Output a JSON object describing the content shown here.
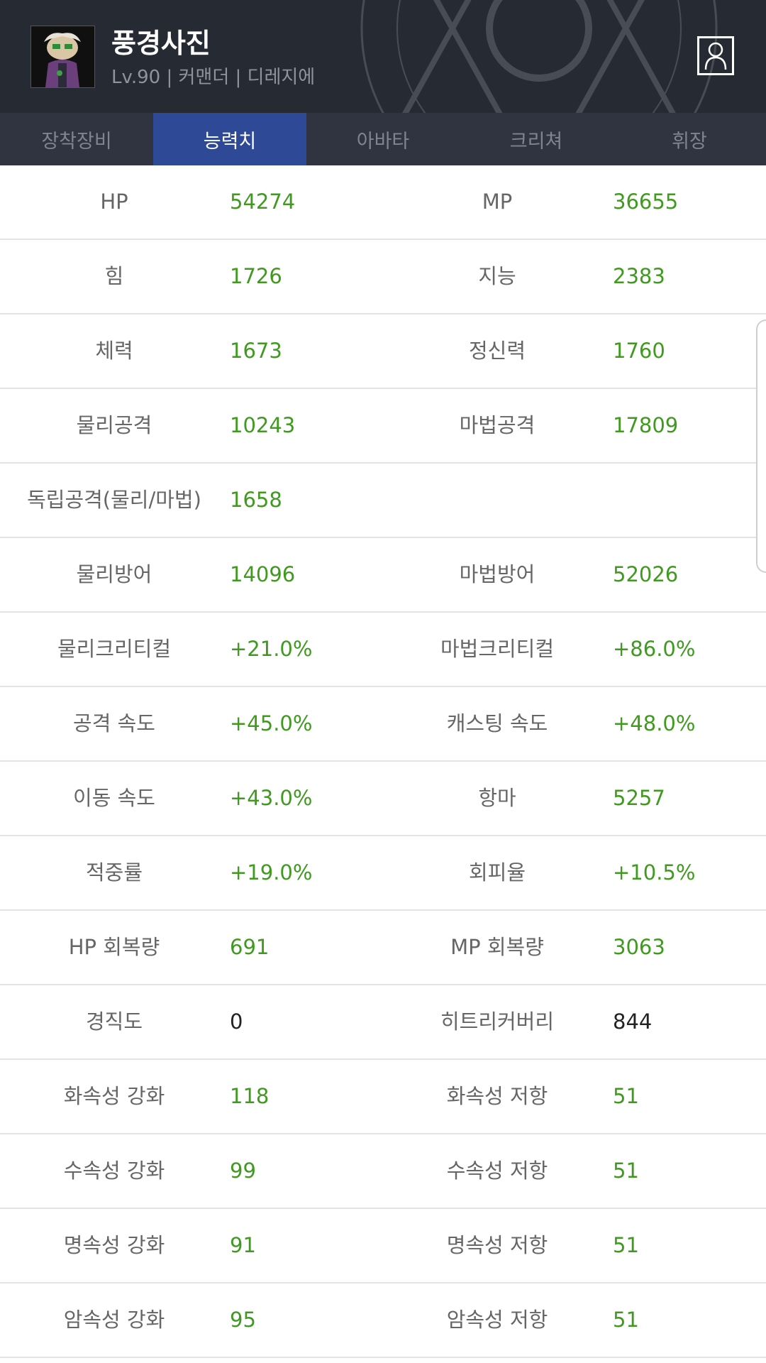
{
  "character": {
    "name": "풍경사진",
    "info": "Lv.90 | 커맨더 | 디레지에"
  },
  "tabs": [
    {
      "label": "장착장비",
      "active": false
    },
    {
      "label": "능력치",
      "active": true
    },
    {
      "label": "아바타",
      "active": false
    },
    {
      "label": "크리쳐",
      "active": false
    },
    {
      "label": "휘장",
      "active": false
    }
  ],
  "stats": [
    {
      "l1": "HP",
      "v1": "54274",
      "l2": "MP",
      "v2": "36655"
    },
    {
      "l1": "힘",
      "v1": "1726",
      "l2": "지능",
      "v2": "2383"
    },
    {
      "l1": "체력",
      "v1": "1673",
      "l2": "정신력",
      "v2": "1760"
    },
    {
      "l1": "물리공격",
      "v1": "10243",
      "l2": "마법공격",
      "v2": "17809"
    },
    {
      "l1": "독립공격(물리/마법)",
      "v1": "1658",
      "l2": "",
      "v2": ""
    },
    {
      "l1": "물리방어",
      "v1": "14096",
      "l2": "마법방어",
      "v2": "52026"
    },
    {
      "l1": "물리크리티컬",
      "v1": "+21.0%",
      "l2": "마법크리티컬",
      "v2": "+86.0%"
    },
    {
      "l1": "공격 속도",
      "v1": "+45.0%",
      "l2": "캐스팅 속도",
      "v2": "+48.0%"
    },
    {
      "l1": "이동 속도",
      "v1": "+43.0%",
      "l2": "항마",
      "v2": "5257"
    },
    {
      "l1": "적중률",
      "v1": "+19.0%",
      "l2": "회피율",
      "v2": "+10.5%"
    },
    {
      "l1": "HP 회복량",
      "v1": "691",
      "l2": "MP 회복량",
      "v2": "3063"
    },
    {
      "l1": "경직도",
      "v1": "0",
      "l2": "히트리커버리",
      "v2": "844"
    },
    {
      "l1": "화속성 강화",
      "v1": "118",
      "l2": "화속성 저항",
      "v2": "51"
    },
    {
      "l1": "수속성 강화",
      "v1": "99",
      "l2": "수속성 저항",
      "v2": "51"
    },
    {
      "l1": "명속성 강화",
      "v1": "91",
      "l2": "명속성 저항",
      "v2": "51"
    },
    {
      "l1": "암속성 강화",
      "v1": "95",
      "l2": "암속성 저항",
      "v2": "51"
    }
  ],
  "icons": {
    "avatar": "character-portrait-icon",
    "profile": "user-profile-icon"
  },
  "colors": {
    "header_bg": "#262a33",
    "tab_bar_bg": "#2f3440",
    "active_tab": "#2e4a97",
    "stat_value_green": "#3f9a1f",
    "label_gray": "#666666"
  }
}
